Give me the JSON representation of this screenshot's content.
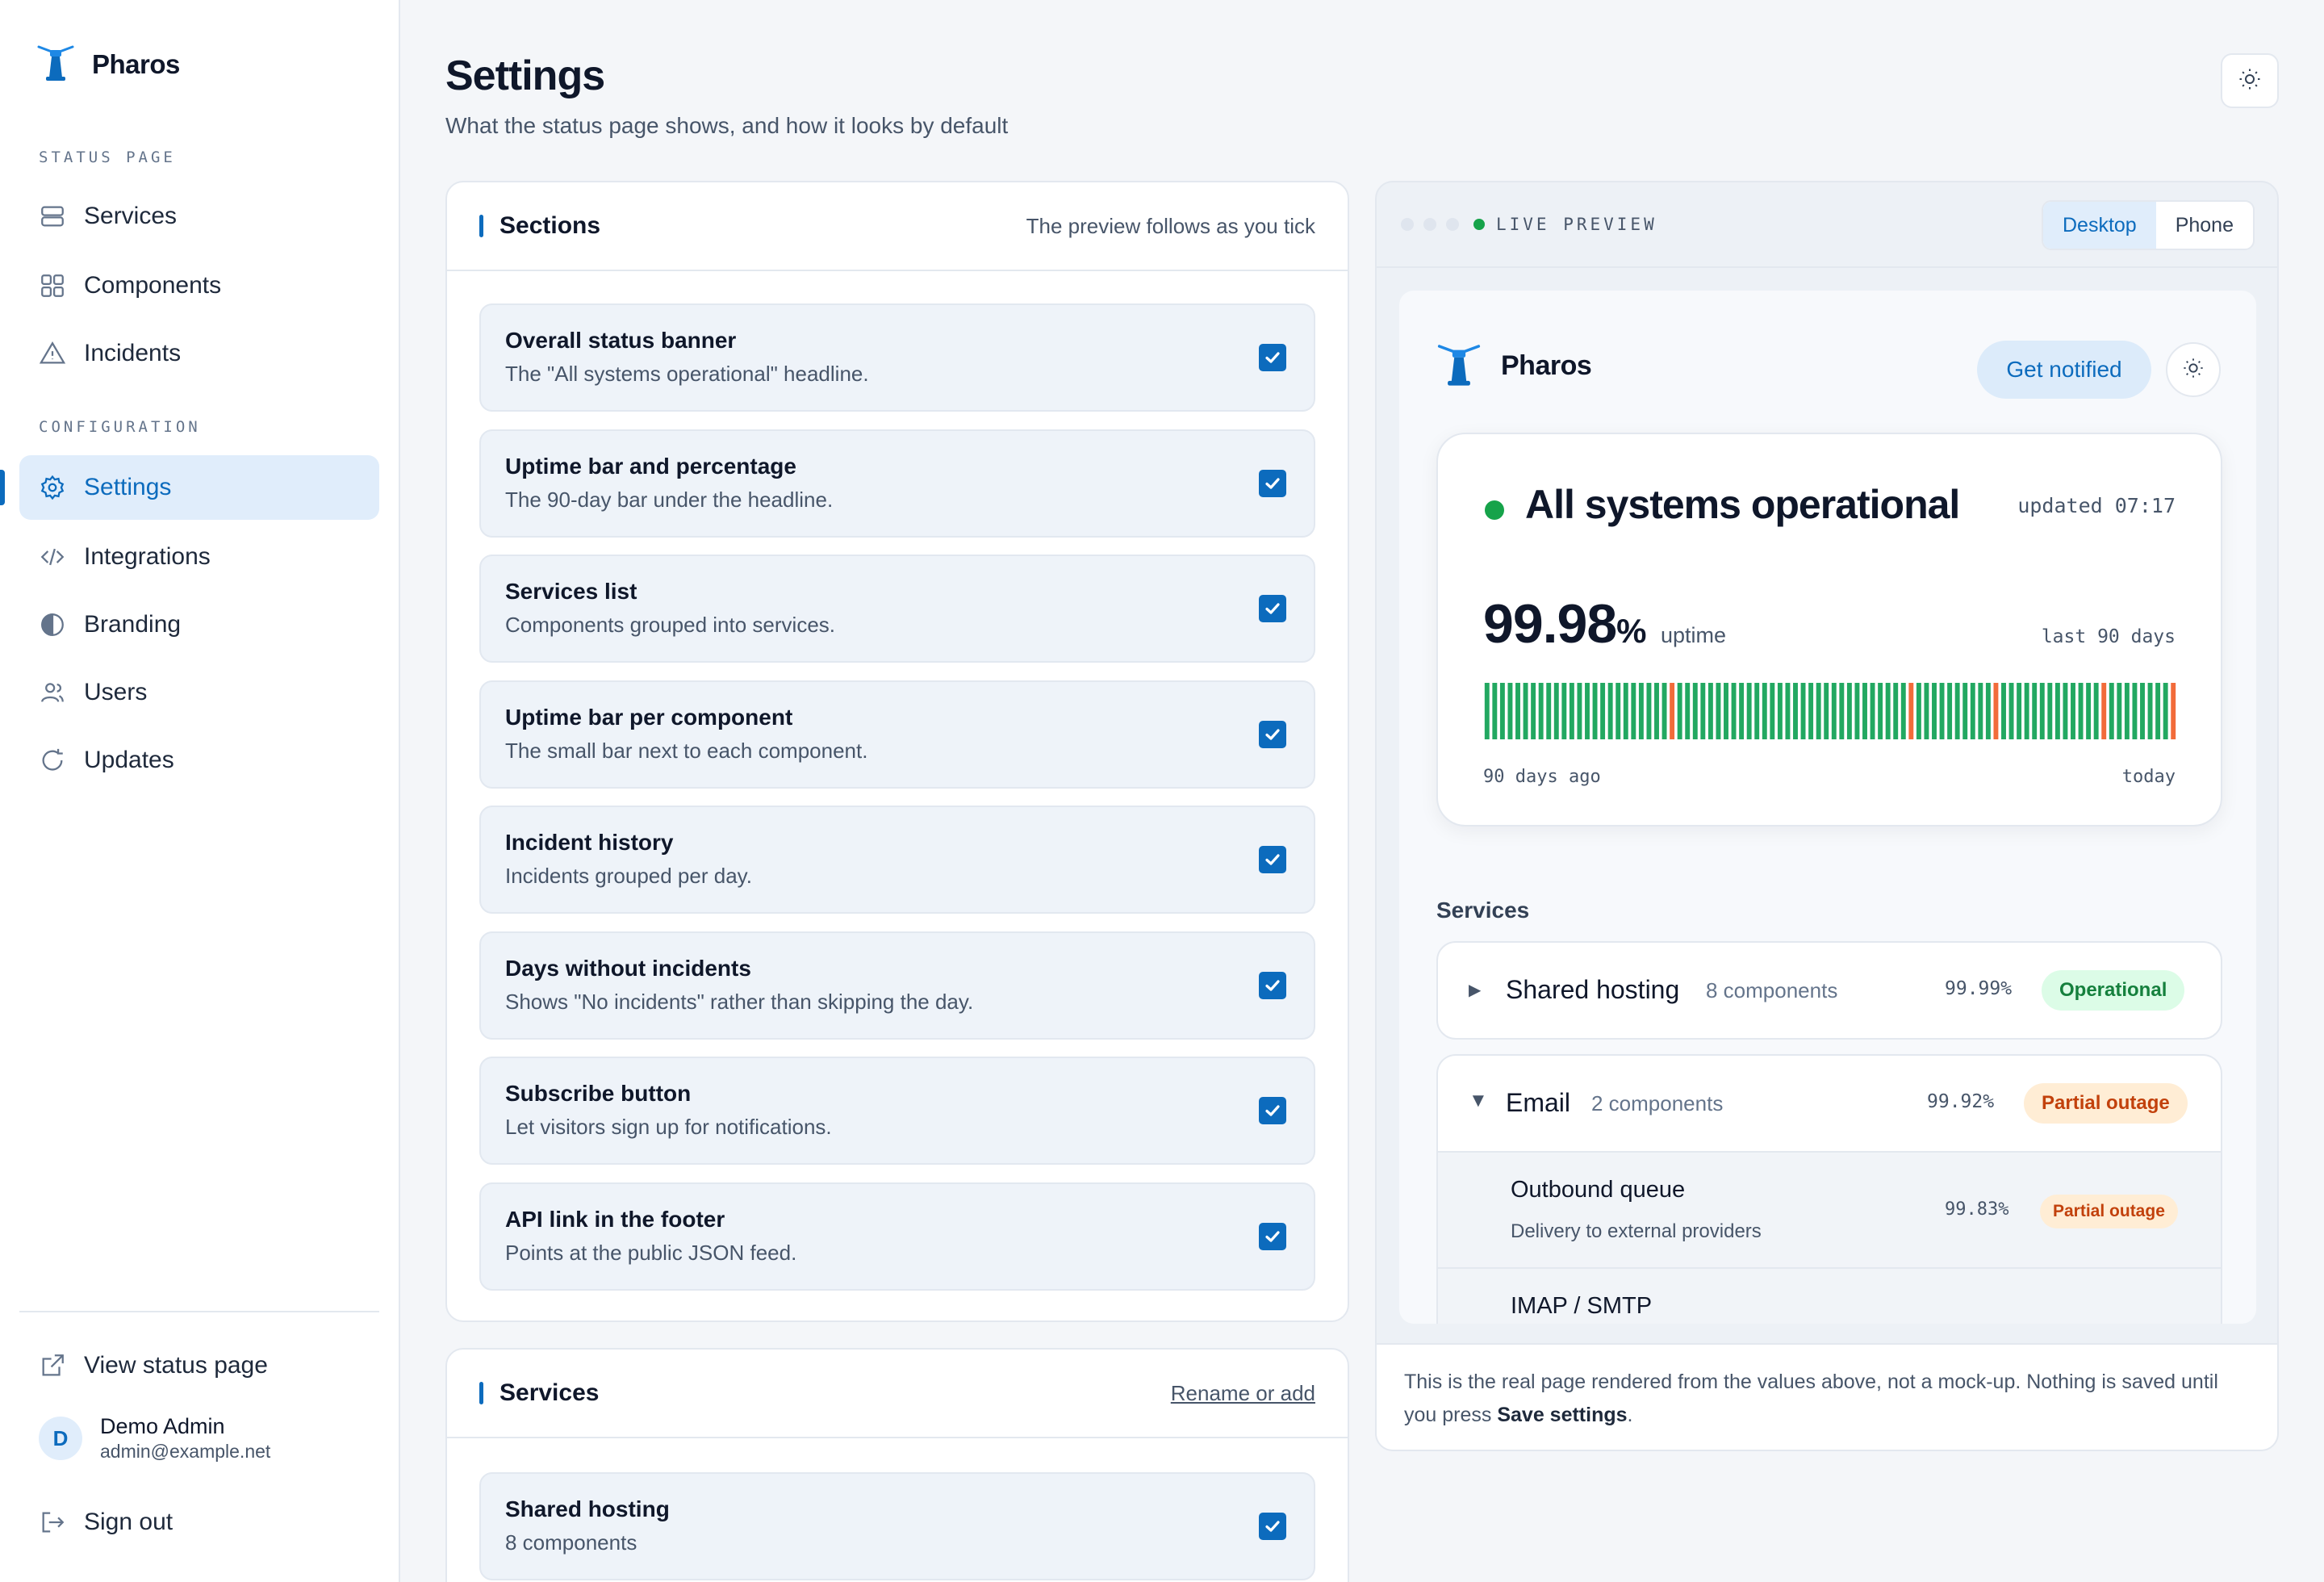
{
  "app": {
    "name": "Pharos"
  },
  "sidebar": {
    "section_status": "STATUS PAGE",
    "section_config": "CONFIGURATION",
    "items": [
      {
        "label": "Services",
        "icon": "server-icon"
      },
      {
        "label": "Components",
        "icon": "grid-icon"
      },
      {
        "label": "Incidents",
        "icon": "warning-icon"
      },
      {
        "label": "Settings",
        "icon": "gear-icon",
        "active": true
      },
      {
        "label": "Integrations",
        "icon": "code-icon"
      },
      {
        "label": "Branding",
        "icon": "contrast-icon"
      },
      {
        "label": "Users",
        "icon": "users-icon"
      },
      {
        "label": "Updates",
        "icon": "refresh-icon"
      }
    ],
    "view_status": "View status page",
    "user": {
      "initial": "D",
      "name": "Demo Admin",
      "email": "admin@example.net"
    },
    "sign_out": "Sign out"
  },
  "header": {
    "title": "Settings",
    "subtitle": "What the status page shows, and how it looks by default"
  },
  "sections_card": {
    "title": "Sections",
    "hint": "The preview follows as you tick",
    "options": [
      {
        "title": "Overall status banner",
        "desc": "The \"All systems operational\" headline.",
        "checked": true
      },
      {
        "title": "Uptime bar and percentage",
        "desc": "The 90-day bar under the headline.",
        "checked": true
      },
      {
        "title": "Services list",
        "desc": "Components grouped into services.",
        "checked": true
      },
      {
        "title": "Uptime bar per component",
        "desc": "The small bar next to each component.",
        "checked": true
      },
      {
        "title": "Incident history",
        "desc": "Incidents grouped per day.",
        "checked": true
      },
      {
        "title": "Days without incidents",
        "desc": "Shows \"No incidents\" rather than skipping the day.",
        "checked": true
      },
      {
        "title": "Subscribe button",
        "desc": "Let visitors sign up for notifications.",
        "checked": true
      },
      {
        "title": "API link in the footer",
        "desc": "Points at the public JSON feed.",
        "checked": true
      }
    ]
  },
  "services_card": {
    "title": "Services",
    "link": "Rename or add",
    "options": [
      {
        "title": "Shared hosting",
        "desc": "8 components",
        "checked": true
      }
    ]
  },
  "preview": {
    "label": "LIVE PREVIEW",
    "modes": [
      "Desktop",
      "Phone"
    ],
    "active_mode": "Desktop",
    "page": {
      "brand": "Pharos",
      "notify": "Get notified",
      "status_headline": "All systems operational",
      "updated": "updated 07:17",
      "uptime_value": "99.98",
      "uptime_sign": "%",
      "uptime_label": "uptime",
      "range_label": "last 90 days",
      "bar_start": "90 days ago",
      "bar_end": "today",
      "uptime_days": {
        "count": 90,
        "degraded_days": [
          24,
          55,
          66,
          80,
          89
        ],
        "colors": {
          "ok": "#22a861",
          "degraded": "#f26b3a"
        }
      },
      "services_heading": "Services",
      "services": [
        {
          "name": "Shared hosting",
          "count": "8 components",
          "pct": "99.99%",
          "status": "Operational",
          "expanded": false
        },
        {
          "name": "Email",
          "count": "2 components",
          "pct": "99.92%",
          "status": "Partial outage",
          "expanded": true,
          "components": [
            {
              "name": "Outbound queue",
              "desc": "Delivery to external providers",
              "pct": "99.83%",
              "status": "Partial outage"
            },
            {
              "name": "IMAP / SMTP"
            }
          ]
        }
      ]
    },
    "note_before": "This is the real page rendered from the values above, not a mock-up. Nothing is saved until you press ",
    "note_bold": "Save settings",
    "note_after": "."
  },
  "colors": {
    "accent": "#0c6bbd",
    "operational": "#16a34a",
    "outage": "#c2410c"
  }
}
